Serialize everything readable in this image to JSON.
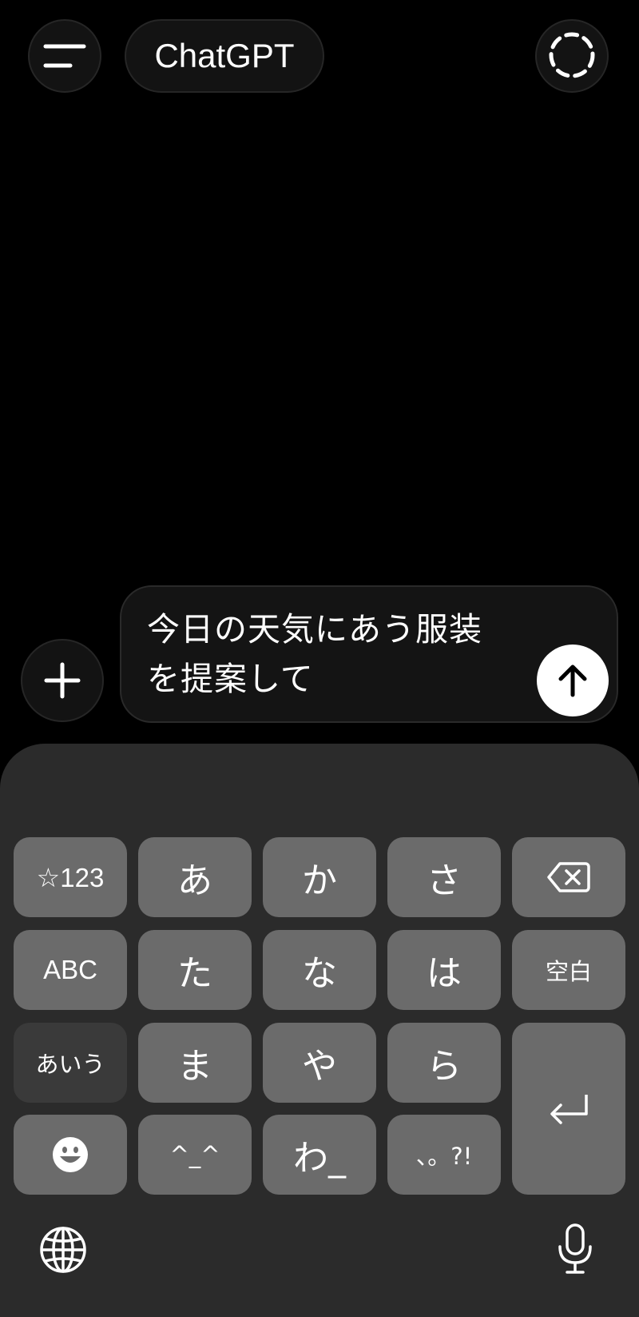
{
  "header": {
    "title": "ChatGPT",
    "menu_icon": "hamburger-menu-icon",
    "chat_icon": "dashed-circle-chat-icon"
  },
  "composer": {
    "input_text": "今日の天気にあう服装を提案して",
    "plus_icon": "plus-icon",
    "send_icon": "arrow-up-icon"
  },
  "keyboard": {
    "keys": {
      "symbols": "☆123",
      "a": "あ",
      "ka": "か",
      "sa": "さ",
      "abc": "ABC",
      "ta": "た",
      "na": "な",
      "ha": "は",
      "space": "空白",
      "kana": "あいう",
      "ma": "ま",
      "ya": "や",
      "ra": "ら",
      "kaomoji": "^_^",
      "wa": "わ_",
      "punct": "、。?!"
    },
    "icons": {
      "backspace": "backspace-icon",
      "enter": "return-icon",
      "emoji": "emoji-icon",
      "globe": "globe-icon",
      "mic": "microphone-icon"
    }
  }
}
